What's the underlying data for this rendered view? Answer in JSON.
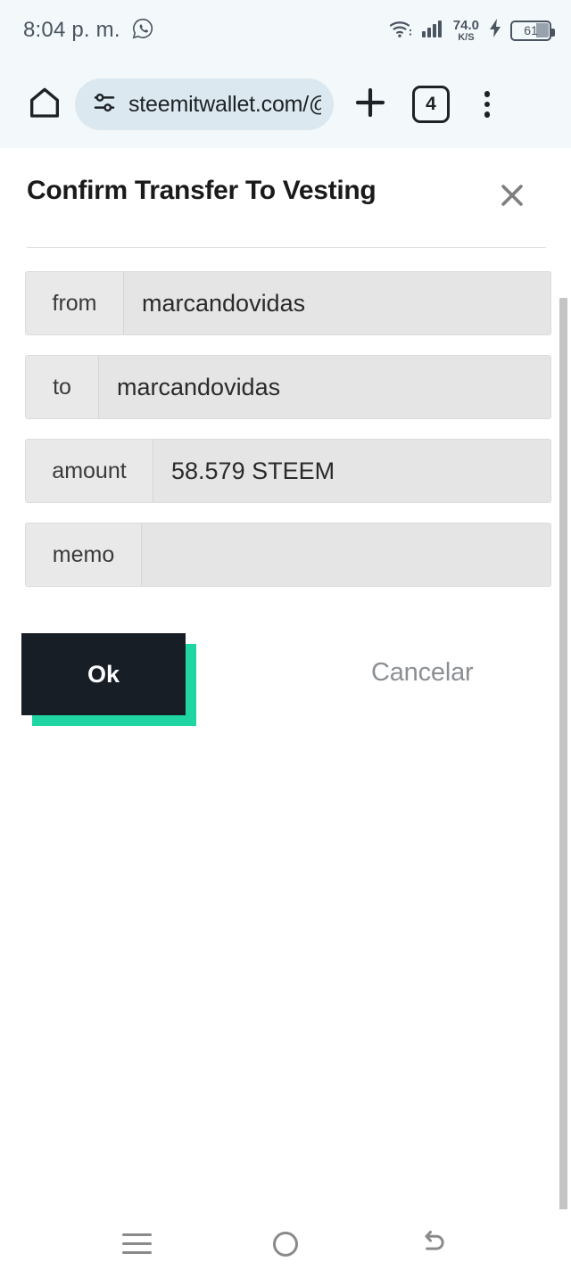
{
  "statusbar": {
    "time": "8:04 p. m.",
    "notification_icon": "whatsapp-icon",
    "wifi_icon": "wifi-icon",
    "signal_icon": "cellular-signal-icon",
    "network_speed_value": "74.0",
    "network_speed_unit": "K/S",
    "charging_icon": "charging-bolt-icon",
    "battery_level": "61"
  },
  "browser": {
    "home_icon": "home-icon",
    "site_settings_icon": "tune-sliders-icon",
    "url": "steemitwallet.com/@",
    "new_tab_icon": "plus-icon",
    "tab_count": "4",
    "menu_icon": "three-dot-menu-icon"
  },
  "dialog": {
    "title": "Confirm Transfer To Vesting",
    "close_icon": "close-x-icon",
    "fields": [
      {
        "label": "from",
        "value": "marcandovidas"
      },
      {
        "label": "to",
        "value": "marcandovidas"
      },
      {
        "label": "amount",
        "value": "58.579 STEEM"
      },
      {
        "label": "memo",
        "value": ""
      }
    ],
    "ok_label": "Ok",
    "cancel_label": "Cancelar",
    "accent_color": "#1fd6a2",
    "ok_button_color": "#171e26"
  },
  "navbar": {
    "recent_icon": "recent-apps-icon",
    "home_icon": "home-circle-icon",
    "back_icon": "back-arrow-icon"
  }
}
